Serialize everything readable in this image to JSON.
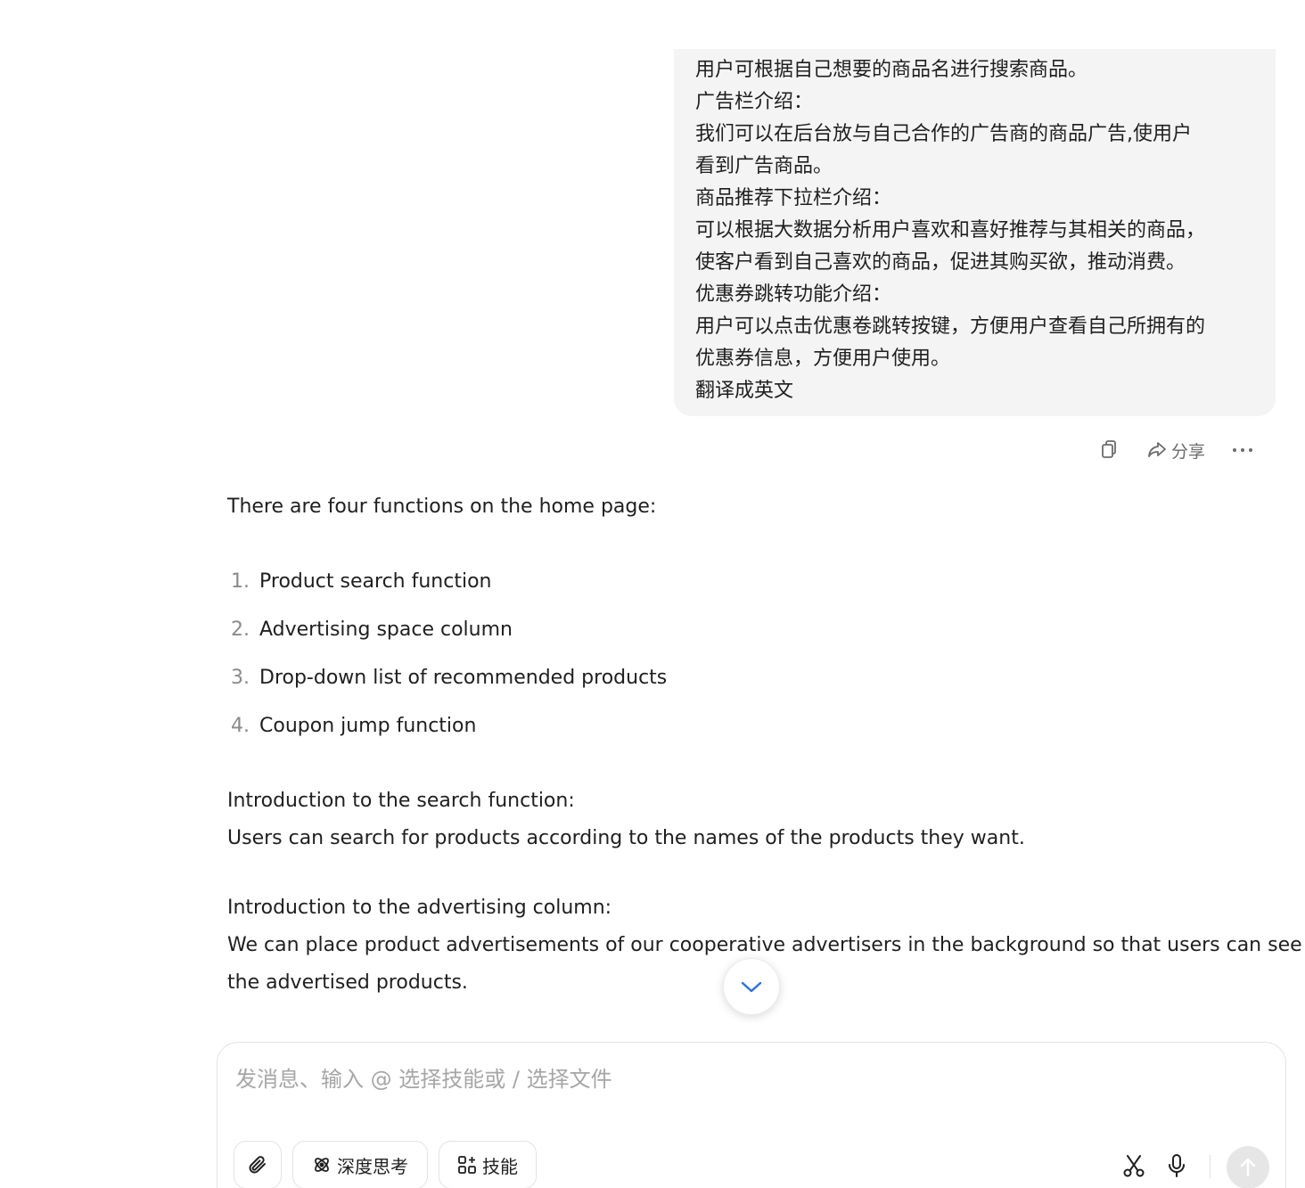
{
  "user_message": {
    "lines": [
      "用户可根据自己想要的商品名进行搜索商品。",
      "广告栏介绍：",
      "我们可以在后台放与自己合作的广告商的商品广告,使用户",
      "看到广告商品。",
      "商品推荐下拉栏介绍：",
      "可以根据大数据分析用户喜欢和喜好推荐与其相关的商品，",
      "使客户看到自己喜欢的商品，促进其购买欲，推动消费。",
      "优惠券跳转功能介绍：",
      "用户可以点击优惠卷跳转按键，方便用户查看自己所拥有的",
      "优惠券信息，方便用户使用。",
      "翻译成英文"
    ]
  },
  "actions": {
    "copy_icon": "copy-icon",
    "share_label": "分享",
    "more_icon": "more-icon"
  },
  "response": {
    "intro": "There are four functions on the home page:",
    "list": [
      {
        "num": "1.",
        "text": "Product search function"
      },
      {
        "num": "2.",
        "text": "Advertising space column"
      },
      {
        "num": "3.",
        "text": "Drop-down list of recommended products"
      },
      {
        "num": "4.",
        "text": "Coupon jump function"
      }
    ],
    "search_heading": "Introduction to the search function:",
    "search_body": "Users can search for products according to the names of the products they want.",
    "ad_heading": "Introduction to the advertising column:",
    "ad_body_line1": "We can place product advertisements of our cooperative advertisers in the background so that users can see",
    "ad_body_line2": "the advertised products."
  },
  "composer": {
    "placeholder": "发消息、输入 @ 选择技能或 / 选择文件",
    "value": "",
    "deep_think_label": "深度思考",
    "skill_label": "技能"
  }
}
